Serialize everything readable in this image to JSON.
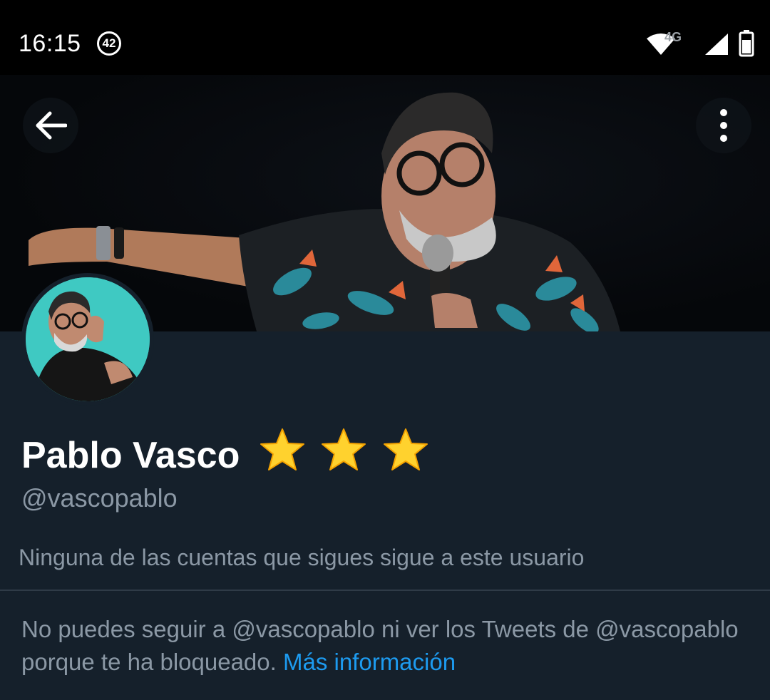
{
  "status_bar": {
    "time": "16:15",
    "notification_count": "42",
    "network_type": "4G"
  },
  "icons": {
    "back": "arrow-left-icon",
    "more": "more-vertical-icon",
    "wifi": "wifi-icon",
    "signal": "signal-icon",
    "battery": "battery-icon"
  },
  "profile": {
    "display_name": "Pablo Vasco",
    "name_badges": "star-emoji x3",
    "handle": "@vascopablo",
    "followers_you_know": "Ninguna de las cuentas que sigues sigue a este usuario"
  },
  "blocked_notice": {
    "message": "No puedes seguir a @vascopablo ni ver los Tweets de @vascopablo porque te ha bloqueado. ",
    "link_label": "Más información"
  },
  "colors": {
    "background": "#15202b",
    "secondary_text": "#8b98a5",
    "link": "#1d9bf0",
    "avatar_bg": "#3fc9c2"
  }
}
